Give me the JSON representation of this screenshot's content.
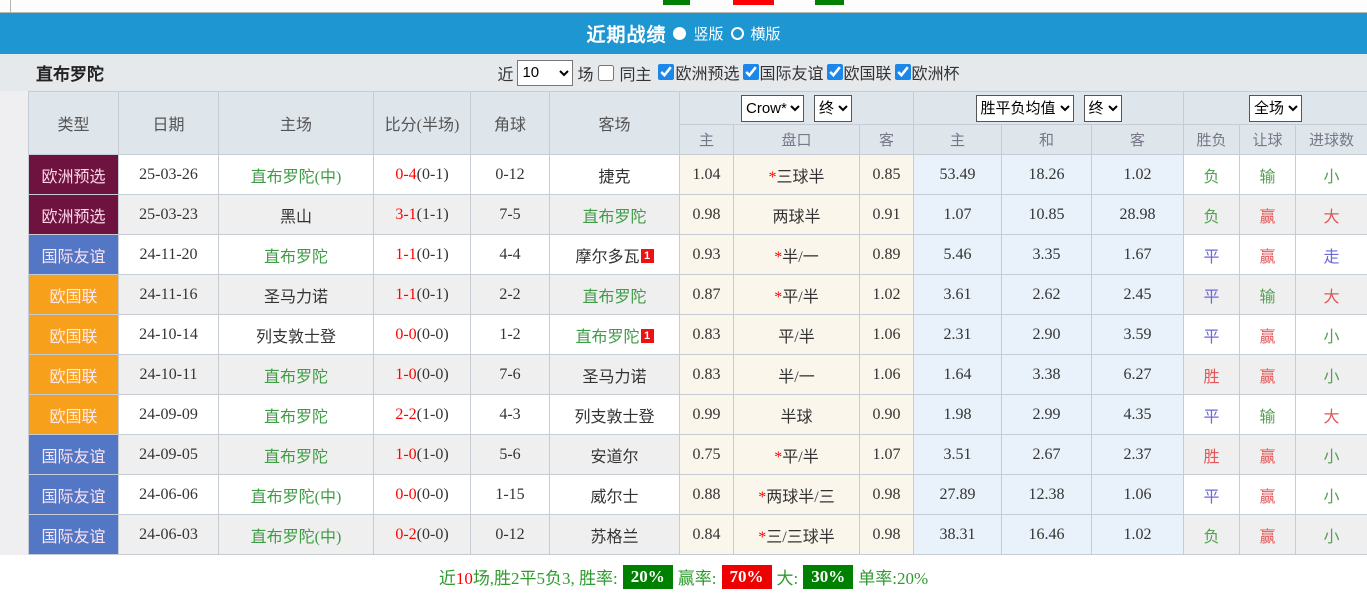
{
  "top_strip": {
    "fragments": [
      "#008000",
      "#ff0000",
      "#008000"
    ]
  },
  "title_bar": {
    "title": "近期战绩",
    "vertical_label": "竖版",
    "horizontal_label": "横版",
    "selected": "竖版"
  },
  "filter": {
    "team": "直布罗陀",
    "near_label": "近",
    "count": "10",
    "matches_label": "场",
    "same_home_label": "同主",
    "leagues": [
      "欧洲预选",
      "国际友谊",
      "欧国联",
      "欧洲杯"
    ]
  },
  "table": {
    "selects": {
      "odds_source": "Crow*",
      "odds_time": "终",
      "avg_source": "胜平负均值",
      "avg_time": "终",
      "scope": "全场"
    },
    "left_headers": [
      "类型",
      "日期",
      "主场",
      "比分(半场)",
      "角球",
      "客场"
    ],
    "sub_headers": [
      "主",
      "盘口",
      "客",
      "主",
      "和",
      "客",
      "胜负",
      "让球",
      "进球数"
    ],
    "league_colors": {
      "欧洲预选": {
        "bg": "#6e1240",
        "fg": "#ffd6e7"
      },
      "国际友谊": {
        "bg": "#5377c5",
        "fg": "#ffe3ef"
      },
      "欧国联": {
        "bg": "#f7a01b",
        "fg": "#ffe9f1"
      }
    },
    "result_colors": {
      "胜": "#e25858",
      "平": "#6b68d8",
      "负": "#55a055",
      "赢": "#e25858",
      "输": "#55a055",
      "走": "#6b68d8",
      "大": "#e25858",
      "小": "#55a055"
    },
    "rows": [
      {
        "type": "欧洲预选",
        "date": "25-03-26",
        "home": "直布罗陀(中)",
        "home_self": true,
        "home_badge": "",
        "score": "0-4",
        "half": "(0-1)",
        "corner": "0-12",
        "away": "捷克",
        "away_self": false,
        "away_badge": "",
        "odds": [
          "1.04",
          "*三球半",
          "0.85"
        ],
        "avg": [
          "53.49",
          "18.26",
          "1.02"
        ],
        "result": "负",
        "handicap_result": "输",
        "goals": "小"
      },
      {
        "type": "欧洲预选",
        "date": "25-03-23",
        "home": "黑山",
        "home_self": false,
        "home_badge": "",
        "score": "3-1",
        "half": "(1-1)",
        "corner": "7-5",
        "away": "直布罗陀",
        "away_self": true,
        "away_badge": "",
        "odds": [
          "0.98",
          "两球半",
          "0.91"
        ],
        "avg": [
          "1.07",
          "10.85",
          "28.98"
        ],
        "result": "负",
        "handicap_result": "赢",
        "goals": "大"
      },
      {
        "type": "国际友谊",
        "date": "24-11-20",
        "home": "直布罗陀",
        "home_self": true,
        "home_badge": "",
        "score": "1-1",
        "half": "(0-1)",
        "corner": "4-4",
        "away": "摩尔多瓦",
        "away_self": false,
        "away_badge": "1",
        "odds": [
          "0.93",
          "*半/一",
          "0.89"
        ],
        "avg": [
          "5.46",
          "3.35",
          "1.67"
        ],
        "result": "平",
        "handicap_result": "赢",
        "goals": "走"
      },
      {
        "type": "欧国联",
        "date": "24-11-16",
        "home": "圣马力诺",
        "home_self": false,
        "home_badge": "",
        "score": "1-1",
        "half": "(0-1)",
        "corner": "2-2",
        "away": "直布罗陀",
        "away_self": true,
        "away_badge": "",
        "odds": [
          "0.87",
          "*平/半",
          "1.02"
        ],
        "avg": [
          "3.61",
          "2.62",
          "2.45"
        ],
        "result": "平",
        "handicap_result": "输",
        "goals": "大"
      },
      {
        "type": "欧国联",
        "date": "24-10-14",
        "home": "列支敦士登",
        "home_self": false,
        "home_badge": "",
        "score": "0-0",
        "half": "(0-0)",
        "corner": "1-2",
        "away": "直布罗陀",
        "away_self": true,
        "away_badge": "1",
        "odds": [
          "0.83",
          "平/半",
          "1.06"
        ],
        "avg": [
          "2.31",
          "2.90",
          "3.59"
        ],
        "result": "平",
        "handicap_result": "赢",
        "goals": "小"
      },
      {
        "type": "欧国联",
        "date": "24-10-11",
        "home": "直布罗陀",
        "home_self": true,
        "home_badge": "",
        "score": "1-0",
        "half": "(0-0)",
        "corner": "7-6",
        "away": "圣马力诺",
        "away_self": false,
        "away_badge": "",
        "odds": [
          "0.83",
          "半/一",
          "1.06"
        ],
        "avg": [
          "1.64",
          "3.38",
          "6.27"
        ],
        "result": "胜",
        "handicap_result": "赢",
        "goals": "小"
      },
      {
        "type": "欧国联",
        "date": "24-09-09",
        "home": "直布罗陀",
        "home_self": true,
        "home_badge": "",
        "score": "2-2",
        "half": "(1-0)",
        "corner": "4-3",
        "away": "列支敦士登",
        "away_self": false,
        "away_badge": "",
        "odds": [
          "0.99",
          "半球",
          "0.90"
        ],
        "avg": [
          "1.98",
          "2.99",
          "4.35"
        ],
        "result": "平",
        "handicap_result": "输",
        "goals": "大"
      },
      {
        "type": "国际友谊",
        "date": "24-09-05",
        "home": "直布罗陀",
        "home_self": true,
        "home_badge": "",
        "score": "1-0",
        "half": "(1-0)",
        "corner": "5-6",
        "away": "安道尔",
        "away_self": false,
        "away_badge": "",
        "odds": [
          "0.75",
          "*平/半",
          "1.07"
        ],
        "avg": [
          "3.51",
          "2.67",
          "2.37"
        ],
        "result": "胜",
        "handicap_result": "赢",
        "goals": "小"
      },
      {
        "type": "国际友谊",
        "date": "24-06-06",
        "home": "直布罗陀(中)",
        "home_self": true,
        "home_badge": "",
        "score": "0-0",
        "half": "(0-0)",
        "corner": "1-15",
        "away": "威尔士",
        "away_self": false,
        "away_badge": "",
        "odds": [
          "0.88",
          "*两球半/三",
          "0.98"
        ],
        "avg": [
          "27.89",
          "12.38",
          "1.06"
        ],
        "result": "平",
        "handicap_result": "赢",
        "goals": "小"
      },
      {
        "type": "国际友谊",
        "date": "24-06-03",
        "home": "直布罗陀(中)",
        "home_self": true,
        "home_badge": "",
        "score": "0-2",
        "half": "(0-0)",
        "corner": "0-12",
        "away": "苏格兰",
        "away_self": false,
        "away_badge": "",
        "odds": [
          "0.84",
          "*三/三球半",
          "0.98"
        ],
        "avg": [
          "38.31",
          "16.46",
          "1.02"
        ],
        "result": "负",
        "handicap_result": "赢",
        "goals": "小"
      }
    ]
  },
  "summary": {
    "near_label": "近",
    "count": "10",
    "record_text": "场,胜2平5负3, 胜率:",
    "win_rate_pct": "20%",
    "win_rate_bg": "#008000",
    "handicap_label": "赢率:",
    "handicap_pct": "70%",
    "handicap_bg": "#ee0000",
    "big_label": "大:",
    "big_pct": "30%",
    "big_bg": "#008000",
    "single_label": "单率:",
    "single_pct": "20%"
  }
}
